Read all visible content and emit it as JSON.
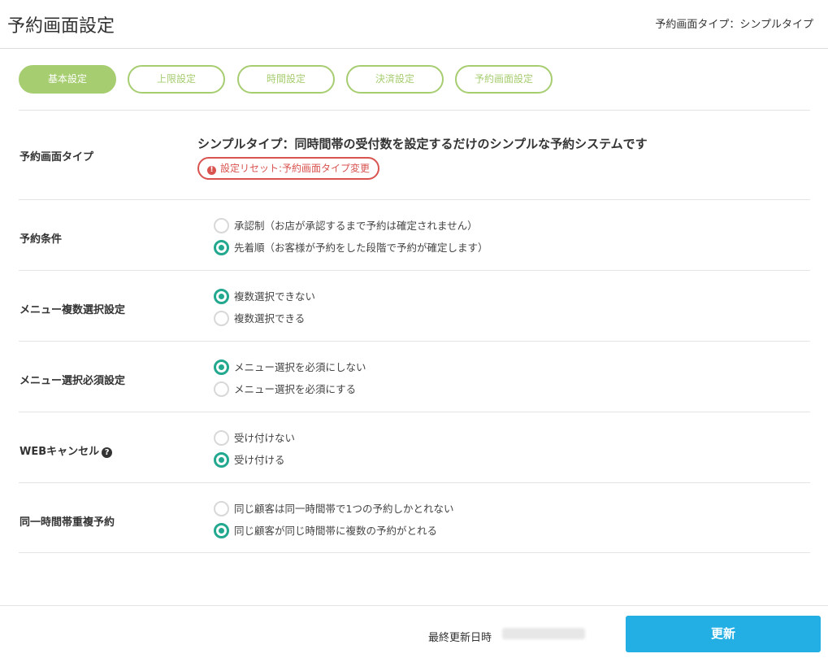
{
  "header": {
    "title": "予約画面設定",
    "page_type": "予約画面タイプ：シンプルタイプ"
  },
  "tabs": [
    {
      "label": "基本設定",
      "active": true
    },
    {
      "label": "上限設定",
      "active": false
    },
    {
      "label": "時間設定",
      "active": false
    },
    {
      "label": "決済設定",
      "active": false
    },
    {
      "label": "予約画面設定",
      "active": false
    }
  ],
  "settings": {
    "screen_type": {
      "label": "予約画面タイプ",
      "description": "シンプルタイプ：同時間帯の受付数を設定するだけのシンプルな予約システムです",
      "reset_button": "設定リセット:予約画面タイプ変更"
    },
    "reservation_condition": {
      "label": "予約条件",
      "options": [
        {
          "label": "承認制（お店が承認するまで予約は確定されません）",
          "checked": false
        },
        {
          "label": "先着順（お客様が予約をした段階で予約が確定します）",
          "checked": true
        }
      ]
    },
    "menu_multi_select": {
      "label": "メニュー複数選択設定",
      "options": [
        {
          "label": "複数選択できない",
          "checked": true
        },
        {
          "label": "複数選択できる",
          "checked": false
        }
      ]
    },
    "menu_required": {
      "label": "メニュー選択必須設定",
      "options": [
        {
          "label": "メニュー選択を必須にしない",
          "checked": true
        },
        {
          "label": "メニュー選択を必須にする",
          "checked": false
        }
      ]
    },
    "web_cancel": {
      "label": "WEBキャンセル",
      "help_icon": "?",
      "options": [
        {
          "label": "受け付けない",
          "checked": false
        },
        {
          "label": "受け付ける",
          "checked": true
        }
      ]
    },
    "duplicate_booking": {
      "label": "同一時間帯重複予約",
      "options": [
        {
          "label": "同じ顧客は同一時間帯で1つの予約しかとれない",
          "checked": false
        },
        {
          "label": "同じ顧客が同じ時間帯に複数の予約がとれる",
          "checked": true
        }
      ]
    }
  },
  "footer": {
    "last_updated_label": "最終更新日時",
    "update_button": "更新"
  },
  "colors": {
    "tab_accent": "#a6cd70",
    "radio_checked": "#22a88f",
    "reset_red": "#d9534f",
    "update_blue": "#23afe4"
  }
}
